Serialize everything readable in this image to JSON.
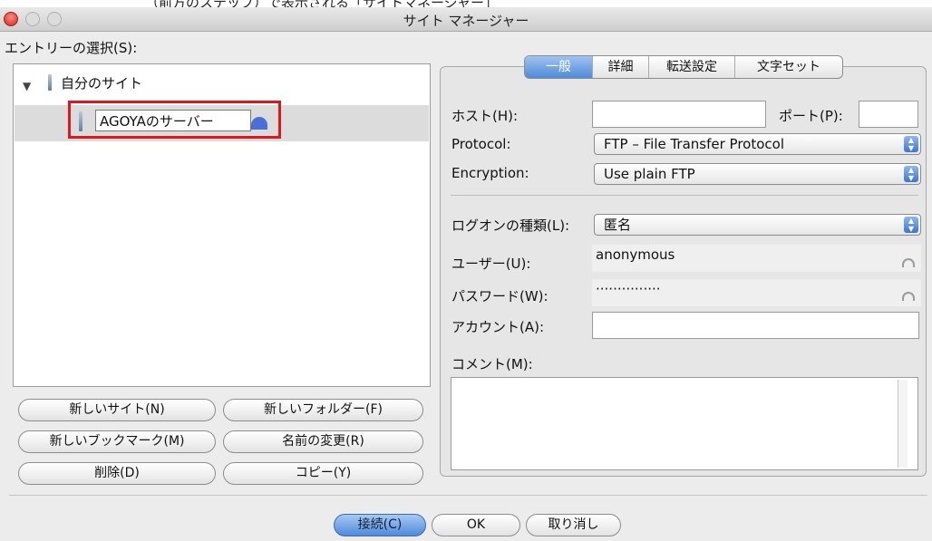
{
  "top_caption": "（前方のステップ）で表示される「サイトマネージャー」",
  "window": {
    "title": "サイト マネージャー"
  },
  "left": {
    "entry_label": "エントリーの選択(S):",
    "tree": {
      "root_label": "自分のサイト",
      "child_label": "AGOYAのサーバー"
    },
    "buttons": {
      "new_site": "新しいサイト(N)",
      "new_folder": "新しいフォルダー(F)",
      "new_bookmark": "新しいブックマーク(M)",
      "rename": "名前の変更(R)",
      "delete": "削除(D)",
      "copy": "コピー(Y)"
    }
  },
  "tabs": [
    "一般",
    "詳細",
    "転送設定",
    "文字セット"
  ],
  "general": {
    "host_label": "ホスト(H):",
    "host_value": "",
    "port_label": "ポート(P):",
    "port_value": "",
    "protocol_label": "Protocol:",
    "protocol_value": "FTP – File Transfer Protocol",
    "encryption_label": "Encryption:",
    "encryption_value": "Use plain FTP",
    "logon_label": "ログオンの種類(L):",
    "logon_value": "匿名",
    "user_label": "ユーザー(U):",
    "user_value": "anonymous",
    "password_label": "パスワード(W):",
    "password_value": "···············",
    "account_label": "アカウント(A):",
    "account_value": "",
    "comment_label": "コメント(M):",
    "comment_value": ""
  },
  "footer": {
    "connect": "接続(C)",
    "ok": "OK",
    "cancel": "取り消し"
  },
  "colors": {
    "highlight": "#e0161c",
    "accent": "#4f8ad9"
  }
}
